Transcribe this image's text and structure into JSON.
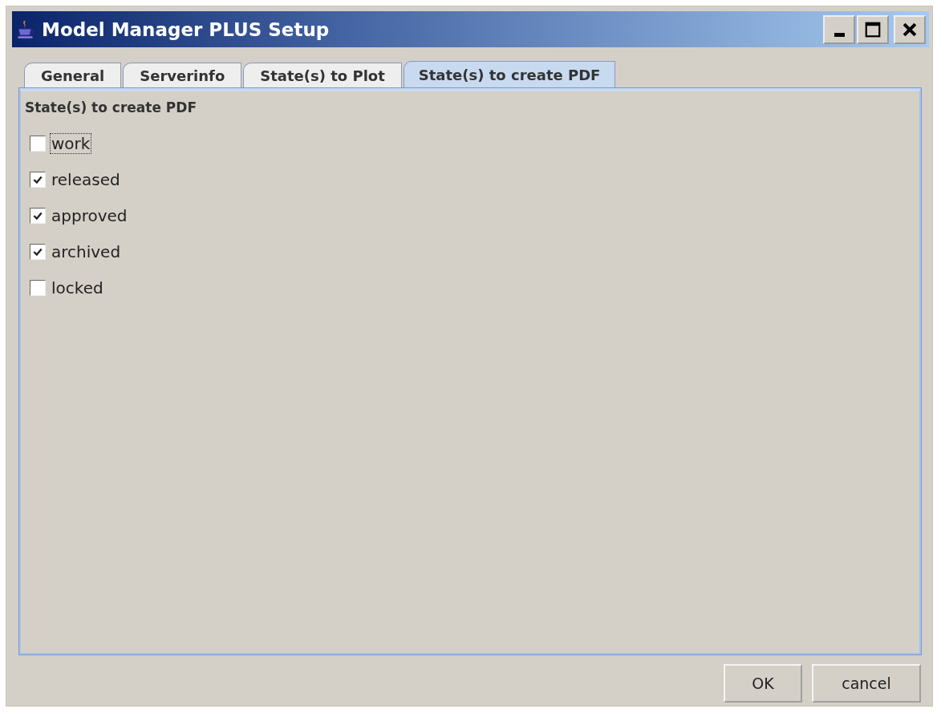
{
  "window": {
    "title": "Model Manager PLUS Setup"
  },
  "tabs": [
    {
      "label": "General",
      "selected": false
    },
    {
      "label": "Serverinfo",
      "selected": false
    },
    {
      "label": "State(s) to Plot",
      "selected": false
    },
    {
      "label": "State(s) to create PDF",
      "selected": true
    }
  ],
  "panel": {
    "heading": "State(s) to create PDF",
    "options": [
      {
        "label": "work",
        "checked": false,
        "focused": true
      },
      {
        "label": "released",
        "checked": true,
        "focused": false
      },
      {
        "label": "approved",
        "checked": true,
        "focused": false
      },
      {
        "label": "archived",
        "checked": true,
        "focused": false
      },
      {
        "label": "locked",
        "checked": false,
        "focused": false
      }
    ]
  },
  "buttons": [
    "OK",
    "cancel"
  ]
}
